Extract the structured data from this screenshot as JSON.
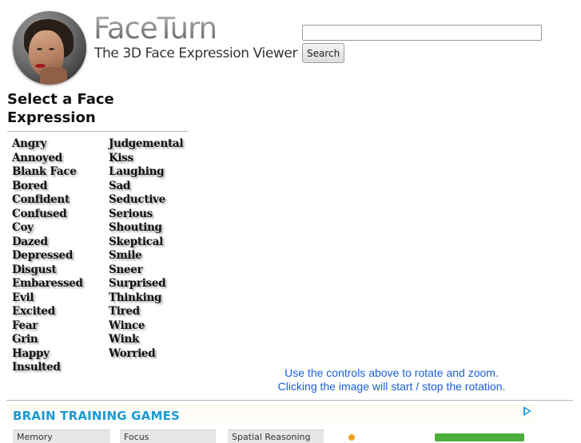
{
  "header": {
    "brand_title": "FaceTurn",
    "brand_subtitle": "The 3D Face Expression Viewer",
    "search": {
      "value": "",
      "placeholder": "",
      "button_label": "Search"
    }
  },
  "sidebar": {
    "heading": "Select a Face Expression",
    "column1": [
      "Angry",
      "Annoyed",
      "Blank Face",
      "Bored",
      "Confident",
      "Confused",
      "Coy",
      "Dazed",
      "Depressed",
      "Disgust",
      "Embaressed",
      "Evil",
      "Excited",
      "Fear",
      "Grin",
      "Happy",
      "Insulted"
    ],
    "column2": [
      "Judgemental",
      "Kiss",
      "Laughing",
      "Sad",
      "Seductive",
      "Serious",
      "Shouting",
      "Skeptical",
      "Smile",
      "Sneer",
      "Surprised",
      "Thinking",
      "Tired",
      "Wince",
      "Wink",
      "Worried"
    ]
  },
  "viewer": {
    "instructions_line1": "Use the controls above to rotate and zoom.",
    "instructions_line2": "Clicking the image will start / stop the rotation."
  },
  "ad": {
    "title": "BRAIN TRAINING GAMES",
    "icons": {
      "ad_choices": "ad-choices-icon"
    },
    "tabs": [
      "Memory",
      "Focus",
      "Spatial Reasoning"
    ]
  },
  "colors": {
    "instructions": "#1a5fd6",
    "ad_title": "#1a9ad6"
  }
}
